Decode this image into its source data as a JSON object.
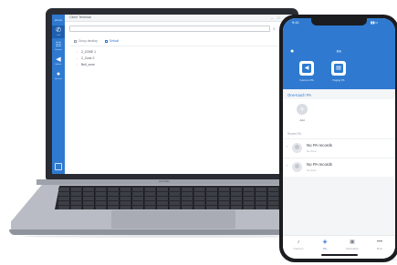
{
  "laptop": {
    "sidebar": {
      "logo": "ekit·tele",
      "items": [
        {
          "label": "Call",
          "icon": "phone-icon"
        },
        {
          "label": "Contacts",
          "icon": "contacts-icon"
        },
        {
          "label": "Bulletin",
          "icon": "megaphone-icon"
        },
        {
          "label": "Account",
          "icon": "person-icon"
        }
      ]
    },
    "app": {
      "title": "Client Terminal",
      "search_placeholder": "",
      "tabs": [
        "Group desktop",
        "Default"
      ],
      "tree": [
        "2_ZONE 1",
        "2_Zone 2",
        "Bell_zone"
      ]
    },
    "brand": "HUAWEI"
  },
  "phone": {
    "status_time": "9:41",
    "header_title": "PA",
    "shortcuts": [
      {
        "label": "Intercom PA",
        "icon": "speaker-icon"
      },
      {
        "label": "Paging PA",
        "icon": "message-icon"
      }
    ],
    "section_title": "One-touch PA",
    "add_label": "Add",
    "recent_title": "Recent PA",
    "records": [
      {
        "title": "No PA records",
        "sub": "No Zone"
      },
      {
        "title": "No PA records",
        "sub": "No Zone"
      }
    ],
    "tabs": [
      {
        "label": "Intercom",
        "icon": "mic-icon"
      },
      {
        "label": "PA",
        "icon": "broadcast-icon"
      },
      {
        "label": "Information",
        "icon": "info-icon"
      },
      {
        "label": "More",
        "icon": "more-icon"
      }
    ]
  },
  "colors": {
    "accent": "#2f7ad0",
    "lid": "#2a2c33",
    "body": "#b9bcc4"
  }
}
